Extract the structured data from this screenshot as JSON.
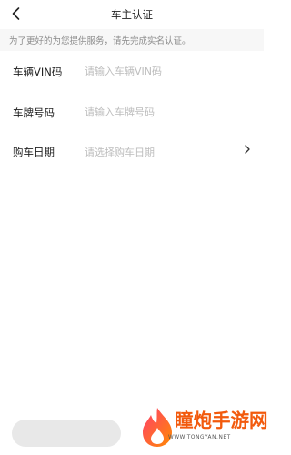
{
  "nav": {
    "title": "车主认证"
  },
  "notice": {
    "text": "为了更好的为您提供服务，请先完成实名认证。"
  },
  "form": {
    "vin": {
      "label": "车辆VIN码",
      "placeholder": "请输入车辆VIN码"
    },
    "plate": {
      "label": "车牌号码",
      "placeholder": "请输入车牌号码"
    },
    "date": {
      "label": "购车日期",
      "placeholder": "请选择购车日期"
    }
  },
  "watermark": {
    "name": "瞳炮手游网",
    "url": "WWW.TONGYAN.NET"
  },
  "colors": {
    "background": "#ffffff",
    "notice_bg": "#f7f7f7",
    "placeholder": "#bdbdbd",
    "button_disabled": "#e8e8e8",
    "watermark_accent": "#f25a0d"
  },
  "icons": {
    "back": "chevron-left-icon",
    "date_arrow": "chevron-right-icon",
    "watermark_logo": "flame-logo-icon"
  }
}
